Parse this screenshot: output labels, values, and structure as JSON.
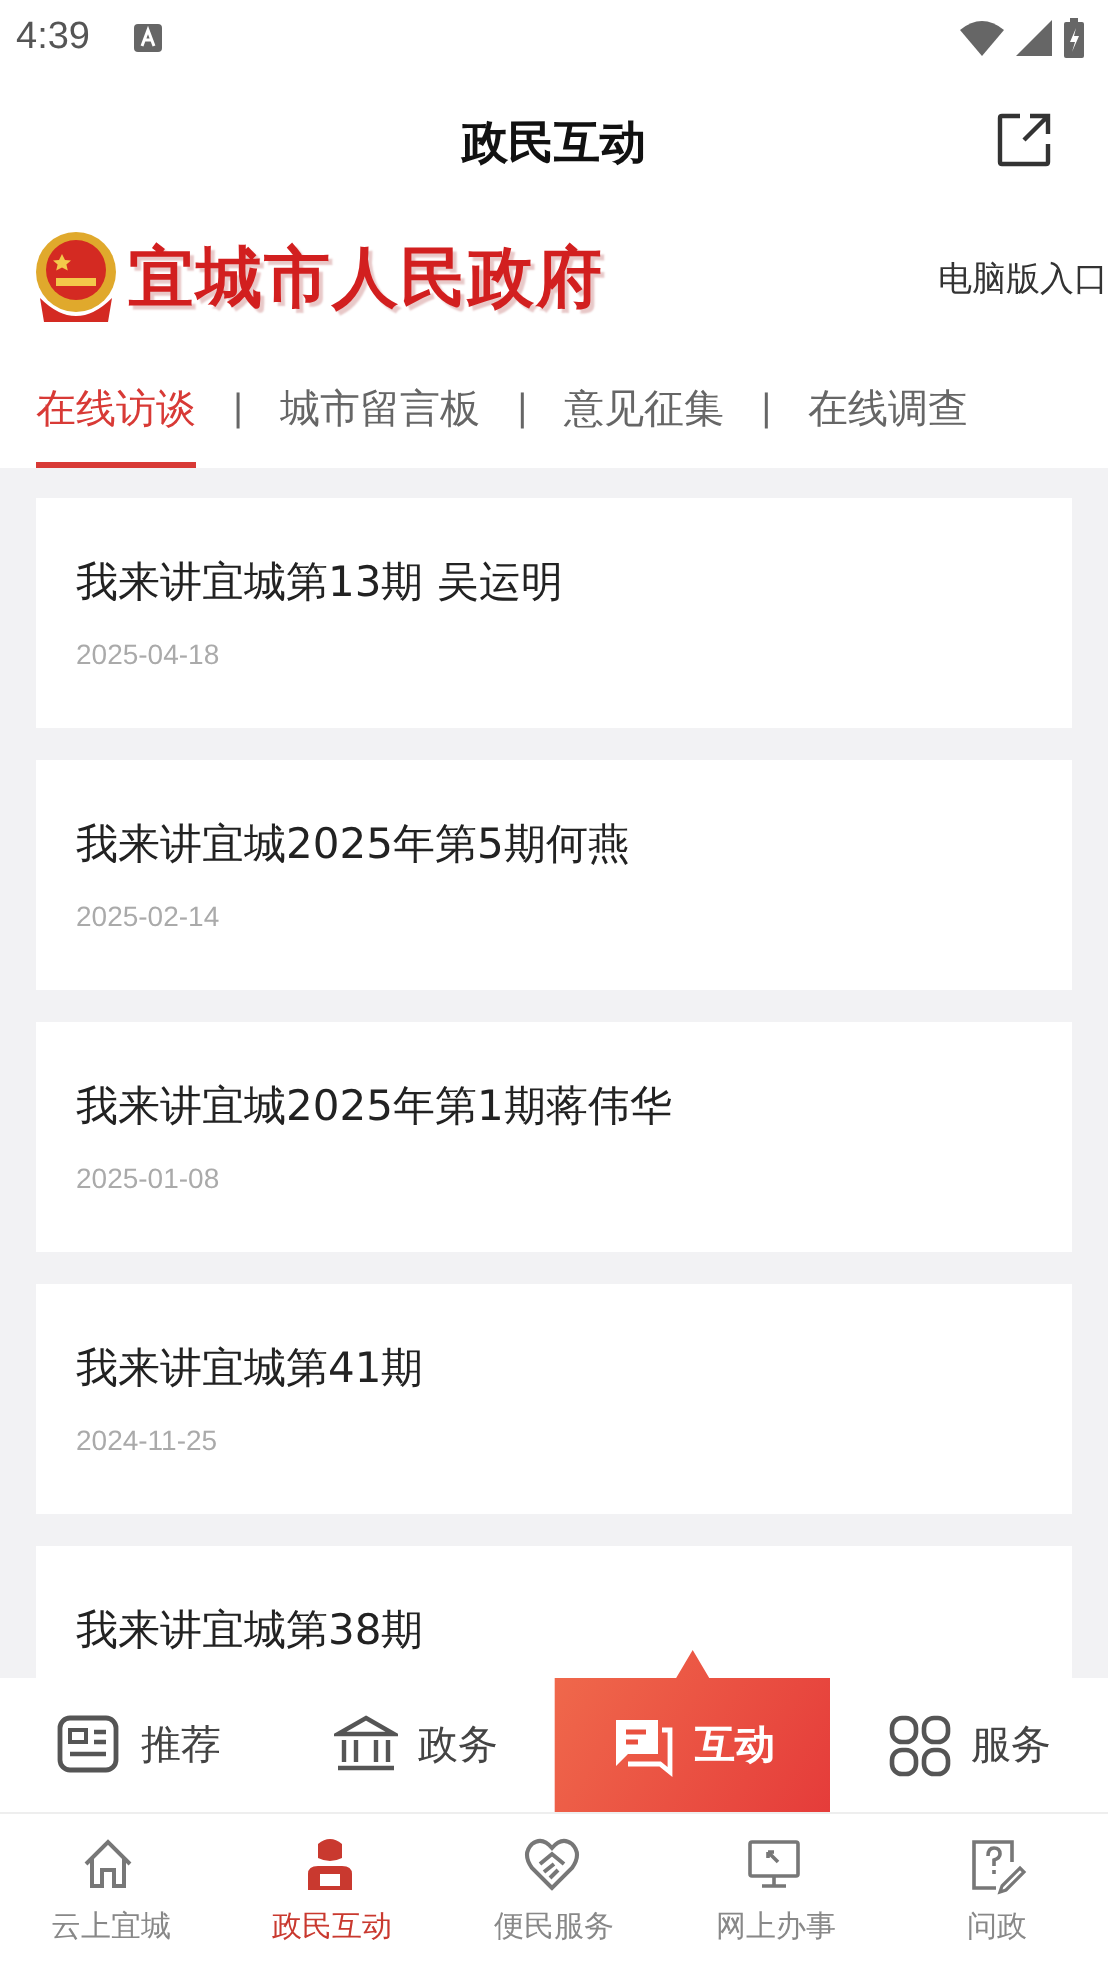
{
  "status_bar": {
    "time": "4:39"
  },
  "header": {
    "title": "政民互动"
  },
  "banner": {
    "logo_text": "宜城市人民政府",
    "link": "电脑版入口"
  },
  "tabs": [
    {
      "label": "在线访谈",
      "selected": true
    },
    {
      "label": "城市留言板",
      "selected": false
    },
    {
      "label": "意见征集",
      "selected": false
    },
    {
      "label": "在线调查",
      "selected": false
    }
  ],
  "separator": "|",
  "articles": [
    {
      "title": "我来讲宜城第13期 吴运明",
      "date": "2025-04-18"
    },
    {
      "title": "我来讲宜城2025年第5期何燕",
      "date": "2025-02-14"
    },
    {
      "title": "我来讲宜城2025年第1期蒋伟华",
      "date": "2025-01-08"
    },
    {
      "title": "我来讲宜城第41期",
      "date": "2024-11-25"
    },
    {
      "title": "我来讲宜城第38期"
    }
  ],
  "quick_bar": [
    {
      "kind": "news",
      "label": "推荐",
      "selected": false
    },
    {
      "kind": "bank",
      "label": "政务",
      "selected": false
    },
    {
      "kind": "chat",
      "label": "互动",
      "selected": true
    },
    {
      "kind": "grid",
      "label": "服务",
      "selected": false
    }
  ],
  "bottom_nav": [
    {
      "kind": "home",
      "label": "云上宜城",
      "selected": false
    },
    {
      "kind": "person",
      "label": "政民互动",
      "selected": true
    },
    {
      "kind": "heart",
      "label": "便民服务",
      "selected": false
    },
    {
      "kind": "monitor",
      "label": "网上办事",
      "selected": false
    },
    {
      "kind": "question",
      "label": "问政",
      "selected": false
    }
  ]
}
